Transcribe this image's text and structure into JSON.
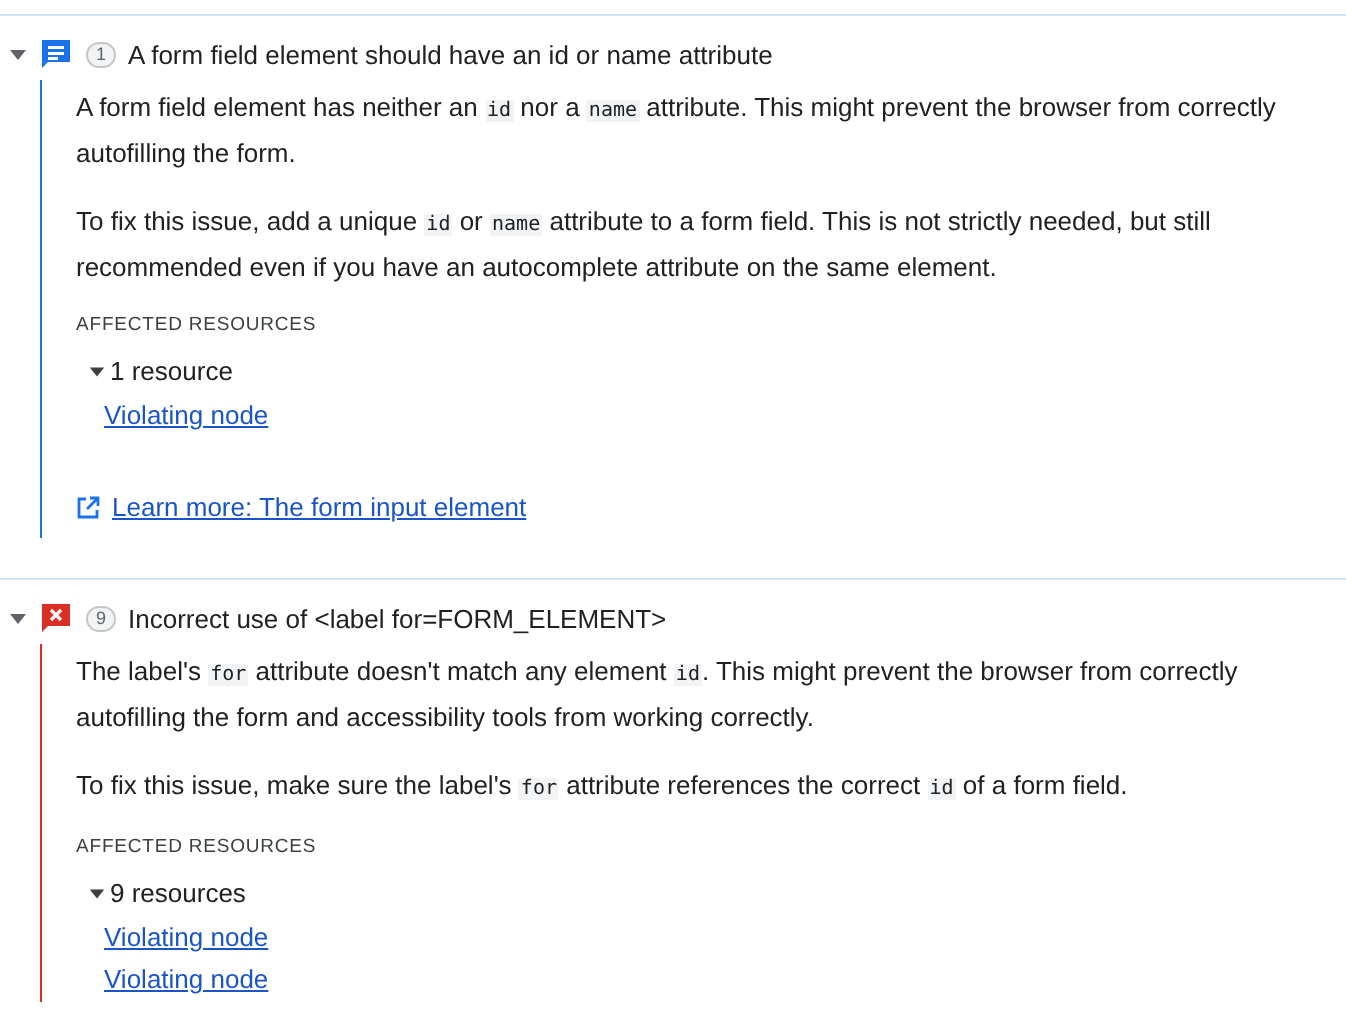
{
  "issues": [
    {
      "kind": "info",
      "expanded": true,
      "count": "1",
      "title": "A form field element should have an id or name attribute",
      "paragraphs": [
        [
          {
            "text": "A form field element has neither an ",
            "code": false
          },
          {
            "text": "id",
            "code": true
          },
          {
            "text": " nor a ",
            "code": false
          },
          {
            "text": "name",
            "code": true
          },
          {
            "text": " attribute. This might prevent the browser from correctly autofilling the form.",
            "code": false
          }
        ],
        [
          {
            "text": "To fix this issue, add a unique ",
            "code": false
          },
          {
            "text": "id",
            "code": true
          },
          {
            "text": " or ",
            "code": false
          },
          {
            "text": "name",
            "code": true
          },
          {
            "text": " attribute to a form field. This is not strictly needed, but still recommended even if you have an autocomplete attribute on the same element.",
            "code": false
          }
        ]
      ],
      "affected_label": "AFFECTED RESOURCES",
      "resources": {
        "label": "1 resource",
        "expanded": true,
        "links": [
          "Violating node"
        ]
      },
      "learn_more": "Learn more: The form input element"
    },
    {
      "kind": "error",
      "expanded": true,
      "count": "9",
      "title": "Incorrect use of <label for=FORM_ELEMENT>",
      "paragraphs": [
        [
          {
            "text": "The label's ",
            "code": false
          },
          {
            "text": "for",
            "code": true
          },
          {
            "text": " attribute doesn't match any element ",
            "code": false
          },
          {
            "text": "id",
            "code": true
          },
          {
            "text": ". This might prevent the browser from correctly autofilling the form and accessibility tools from working correctly.",
            "code": false
          }
        ],
        [
          {
            "text": "To fix this issue, make sure the label's ",
            "code": false
          },
          {
            "text": "for",
            "code": true
          },
          {
            "text": " attribute references the correct ",
            "code": false
          },
          {
            "text": "id",
            "code": true
          },
          {
            "text": " of a form field.",
            "code": false
          }
        ]
      ],
      "affected_label": "AFFECTED RESOURCES",
      "resources": {
        "label": "9 resources",
        "expanded": true,
        "links": [
          "Violating node",
          "Violating node"
        ]
      }
    }
  ]
}
